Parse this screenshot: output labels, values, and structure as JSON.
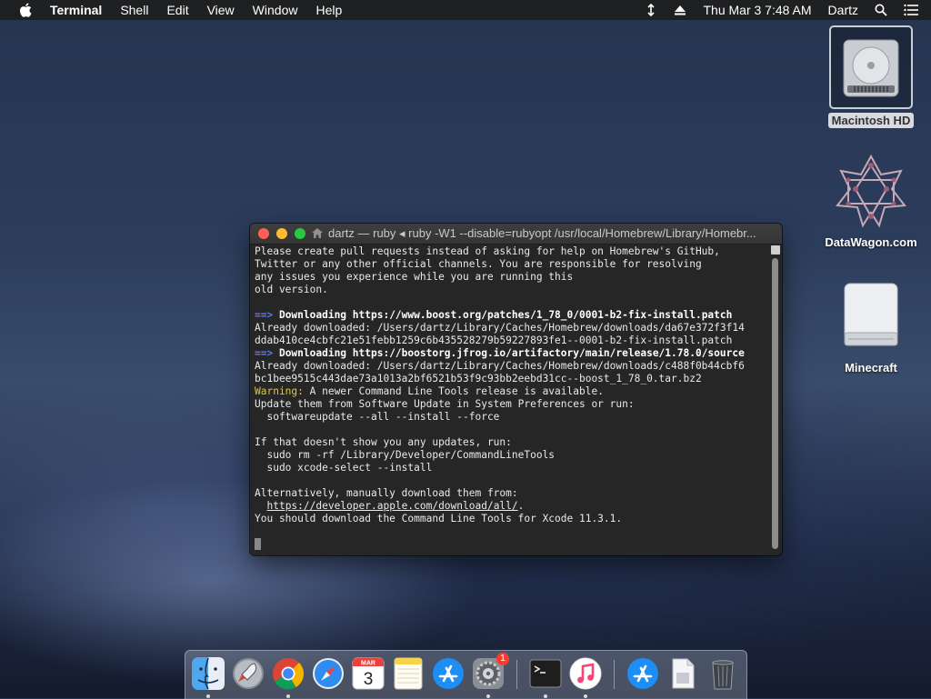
{
  "menubar": {
    "app_name": "Terminal",
    "menus": [
      "Shell",
      "Edit",
      "View",
      "Window",
      "Help"
    ],
    "clock": "Thu Mar 3  7:48 AM",
    "user": "Dartz",
    "icons": [
      "apple-icon",
      "input-menu-icon",
      "eject-icon",
      "spotlight-search-icon",
      "notification-center-icon"
    ]
  },
  "desktop": {
    "items": [
      {
        "label": "Macintosh HD",
        "icon": "hard-drive-icon",
        "selected": true
      },
      {
        "label": "DataWagon.com",
        "icon": "datawagon-icon",
        "selected": false
      },
      {
        "label": "Minecraft",
        "icon": "removable-drive-icon",
        "selected": false
      }
    ]
  },
  "terminal": {
    "title": "dartz — ruby ◂ ruby -W1 --disable=rubyopt /usr/local/Homebrew/Library/Homebr...",
    "lines": [
      {
        "type": "plain",
        "text": "Please create pull requests instead of asking for help on Homebrew's GitHub,"
      },
      {
        "type": "plain",
        "text": "Twitter or any other official channels. You are responsible for resolving"
      },
      {
        "type": "plain",
        "text": "any issues you experience while you are running this"
      },
      {
        "type": "plain",
        "text": "old version."
      },
      {
        "type": "plain",
        "text": ""
      },
      {
        "type": "header",
        "arrow": "==>",
        "text": " Downloading https://www.boost.org/patches/1_78_0/0001-b2-fix-install.patch"
      },
      {
        "type": "plain",
        "text": "Already downloaded: /Users/dartz/Library/Caches/Homebrew/downloads/da67e372f3f14"
      },
      {
        "type": "plain",
        "text": "ddab410ce4cbfc21e51febb1259c6b435528279b59227893fe1--0001-b2-fix-install.patch"
      },
      {
        "type": "header",
        "arrow": "==>",
        "text": " Downloading https://boostorg.jfrog.io/artifactory/main/release/1.78.0/source"
      },
      {
        "type": "plain",
        "text": "Already downloaded: /Users/dartz/Library/Caches/Homebrew/downloads/c488f0b44cbf6"
      },
      {
        "type": "plain",
        "text": "bc1bee9515c443dae73a1013a2bf6521b53f9c93bb2eebd31cc--boost_1_78_0.tar.bz2"
      },
      {
        "type": "warning",
        "label": "Warning:",
        "text": " A newer Command Line Tools release is available."
      },
      {
        "type": "plain",
        "text": "Update them from Software Update in System Preferences or run:"
      },
      {
        "type": "plain",
        "text": "  softwareupdate --all --install --force"
      },
      {
        "type": "plain",
        "text": ""
      },
      {
        "type": "plain",
        "text": "If that doesn't show you any updates, run:"
      },
      {
        "type": "plain",
        "text": "  sudo rm -rf /Library/Developer/CommandLineTools"
      },
      {
        "type": "plain",
        "text": "  sudo xcode-select --install"
      },
      {
        "type": "plain",
        "text": ""
      },
      {
        "type": "plain",
        "text": "Alternatively, manually download them from:"
      },
      {
        "type": "link",
        "indent": "  ",
        "link": "https://developer.apple.com/download/all/",
        "after": "."
      },
      {
        "type": "plain",
        "text": "You should download the Command Line Tools for Xcode 11.3.1."
      },
      {
        "type": "plain",
        "text": ""
      },
      {
        "type": "cursor",
        "text": ""
      }
    ]
  },
  "dock": {
    "items": [
      {
        "name": "finder",
        "running": true
      },
      {
        "name": "launchpad",
        "running": false
      },
      {
        "name": "google-chrome",
        "running": true
      },
      {
        "name": "safari",
        "running": false
      },
      {
        "name": "calendar",
        "running": false,
        "month": "MAR",
        "day": "3"
      },
      {
        "name": "notes",
        "running": false
      },
      {
        "name": "app-store",
        "running": false
      },
      {
        "name": "system-preferences",
        "running": true,
        "badge": "1"
      },
      {
        "name": "terminal",
        "running": true
      },
      {
        "name": "itunes",
        "running": true
      },
      {
        "name": "app-store-downloads",
        "running": false
      },
      {
        "name": "documents",
        "running": false
      },
      {
        "name": "trash",
        "running": false
      }
    ]
  },
  "colors": {
    "arrow": "#5c78ff",
    "warning": "#e0c547",
    "terminal_bg": "#262626",
    "close": "#ff5f57",
    "minimize": "#febc2e",
    "zoom": "#28c840"
  }
}
